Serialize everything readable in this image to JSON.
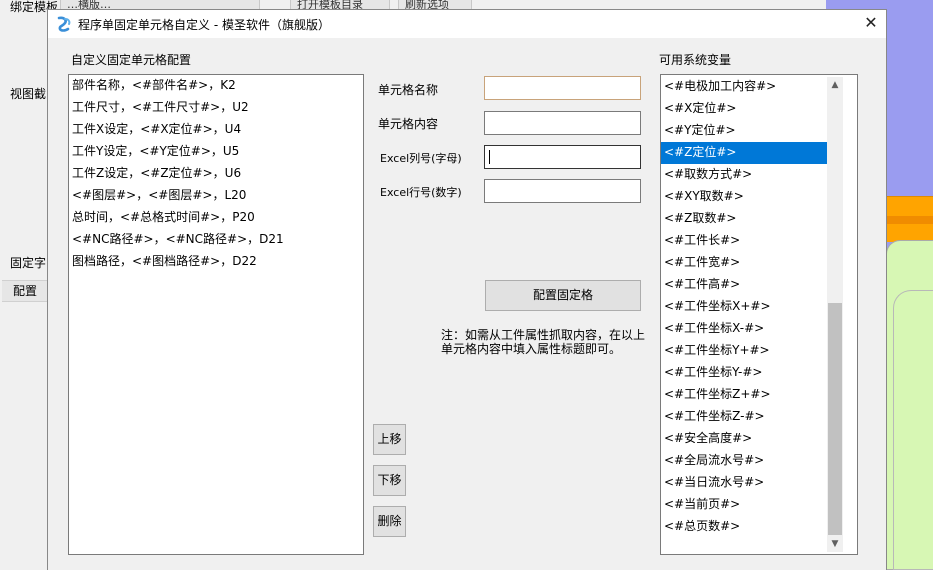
{
  "background": {
    "topbar_label": "绑定模板",
    "topbar_chip1": "…横版…",
    "topbar_chip2": "打开模板目录",
    "topbar_chip3": "刷新选项",
    "view_label": "视图截",
    "fixed_label": "固定字",
    "config_tab": "配置",
    "colors": {
      "right_panel": "#9a9cf0",
      "orange": "#ffa400",
      "green": "#d7f7b4"
    }
  },
  "dialog": {
    "title": "程序单固定单元格自定义 - 模圣软件（旗舰版）",
    "logo_icon": "app-logo-icon",
    "close_label": "✕",
    "custom_cells_label": "自定义固定单元格配置",
    "variables_label": "可用系统变量",
    "cell_list": [
      "部件名称，<#部件名#>，K2",
      "工件尺寸，<#工件尺寸#>，U2",
      "工件X设定，<#X定位#>，U4",
      "工件Y设定，<#Y定位#>，U5",
      "工件Z设定，<#Z定位#>，U6",
      "<#图层#>，<#图层#>，L20",
      "总时间，<#总格式时间#>，P20",
      "<#NC路径#>，<#NC路径#>，D21",
      "图档路径，<#图档路径#>，D22"
    ],
    "form": {
      "cell_name_label": "单元格名称",
      "cell_name_value": "",
      "cell_content_label": "单元格内容",
      "cell_content_value": "",
      "excel_col_label": "Excel列号(字母)",
      "excel_col_value": "",
      "excel_row_label": "Excel行号(数字)",
      "excel_row_value": ""
    },
    "configure_button": "配置固定格",
    "note_text": "注：如需从工件属性抓取内容，在以上单元格内容中填入属性标题即可。",
    "move_up_button": "上移",
    "move_down_button": "下移",
    "delete_button": "删除",
    "variables": [
      "<#电极加工内容#>",
      "<#X定位#>",
      "<#Y定位#>",
      "<#Z定位#>",
      "<#取数方式#>",
      "<#XY取数#>",
      "<#Z取数#>",
      "<#工件长#>",
      "<#工件宽#>",
      "<#工件高#>",
      "<#工件坐标X+#>",
      "<#工件坐标X-#>",
      "<#工件坐标Y+#>",
      "<#工件坐标Y-#>",
      "<#工件坐标Z+#>",
      "<#工件坐标Z-#>",
      "<#安全高度#>",
      "<#全局流水号#>",
      "<#当日流水号#>",
      "<#当前页#>",
      "<#总页数#>"
    ],
    "selected_variable": "<#Z定位#>",
    "selection_color": "#0078d7"
  }
}
